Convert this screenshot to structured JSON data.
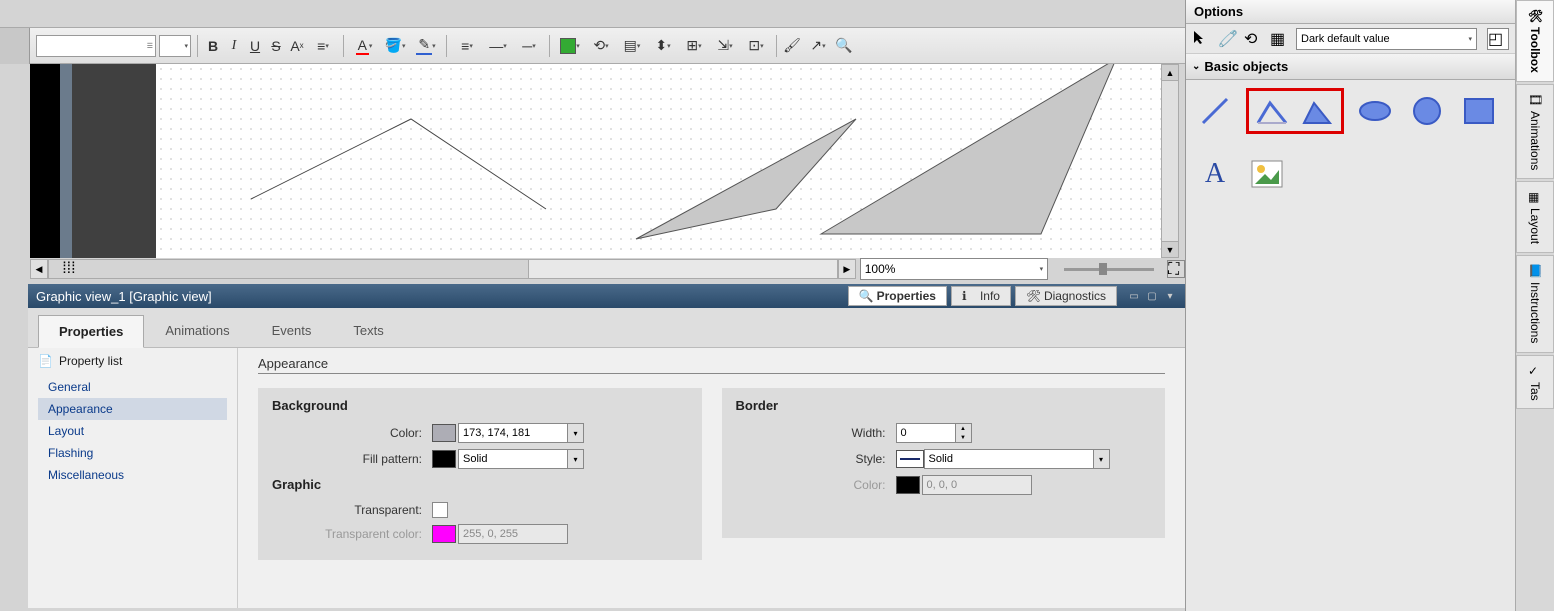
{
  "toolbar": {
    "bold": "B",
    "italic": "I",
    "underline": "U",
    "strike": "S",
    "super": "A"
  },
  "zoom": {
    "value": "100%"
  },
  "divider": {
    "title": "Graphic view_1 [Graphic view]",
    "tab_properties": "Properties",
    "tab_info": "Info",
    "tab_diag": "Diagnostics"
  },
  "lowerTabs": {
    "properties": "Properties",
    "animations": "Animations",
    "events": "Events",
    "texts": "Texts"
  },
  "propNav": {
    "header": "Property list",
    "items": {
      "general": "General",
      "appearance": "Appearance",
      "layout": "Layout",
      "flashing": "Flashing",
      "misc": "Miscellaneous"
    }
  },
  "props": {
    "title": "Appearance",
    "background": {
      "title": "Background",
      "colorLabel": "Color:",
      "colorValue": "173, 174, 181",
      "colorHex": "#adadb5",
      "fillLabel": "Fill pattern:",
      "fillValue": "Solid",
      "fillSwatch": "#000000"
    },
    "graphic": {
      "title": "Graphic",
      "transparentLabel": "Transparent:",
      "tcolorLabel": "Transparent color:",
      "tcolorValue": "255, 0, 255",
      "tcolorHex": "#ff00ff"
    },
    "border": {
      "title": "Border",
      "widthLabel": "Width:",
      "widthValue": "0",
      "styleLabel": "Style:",
      "styleValue": "Solid",
      "colorLabel": "Color:",
      "colorValue": "0, 0, 0",
      "colorHex": "#000000"
    }
  },
  "options": {
    "header": "Options",
    "select": "Dark default value",
    "panel": "Basic objects",
    "textShape": "A"
  },
  "rightTabs": {
    "toolbox": "Toolbox",
    "animations": "Animations",
    "layout": "Layout",
    "instructions": "Instructions",
    "tasks": "Tas"
  }
}
